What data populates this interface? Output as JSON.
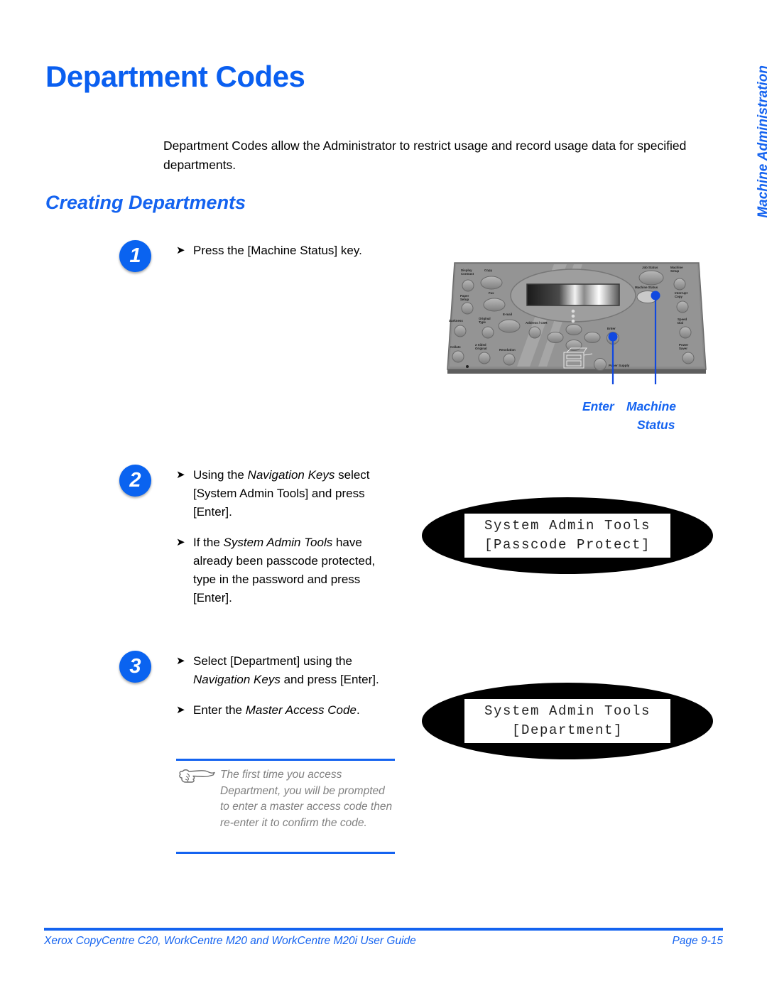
{
  "page": {
    "title": "Department Codes",
    "intro": "Department Codes allow the Administrator to restrict usage and record usage data for specified departments.",
    "section_heading": "Creating Departments",
    "side_tab": "Machine Administration",
    "title_color": "#0a5ff0",
    "accent_color": "#1463f0"
  },
  "steps": [
    {
      "number": "1",
      "bullets": [
        {
          "parts": [
            {
              "t": "Press the [Machine Status] key.",
              "style": "normal"
            }
          ]
        }
      ]
    },
    {
      "number": "2",
      "bullets": [
        {
          "parts": [
            {
              "t": "Using the ",
              "style": "normal"
            },
            {
              "t": "Navigation Keys",
              "style": "italic"
            },
            {
              "t": " select [System Admin Tools] and press [Enter].",
              "style": "normal"
            }
          ]
        },
        {
          "parts": [
            {
              "t": "If the ",
              "style": "normal"
            },
            {
              "t": "System Admin Tools",
              "style": "italic"
            },
            {
              "t": " have already been passcode protected, type in the password and press [Enter].",
              "style": "normal"
            }
          ]
        }
      ]
    },
    {
      "number": "3",
      "bullets": [
        {
          "parts": [
            {
              "t": "Select [Department] using the ",
              "style": "normal"
            },
            {
              "t": "Navigation Keys",
              "style": "italic"
            },
            {
              "t": " and press [Enter].",
              "style": "normal"
            }
          ]
        },
        {
          "parts": [
            {
              "t": "Enter the ",
              "style": "normal"
            },
            {
              "t": "Master Access Code",
              "style": "italic"
            },
            {
              "t": ".",
              "style": "normal"
            }
          ]
        }
      ]
    }
  ],
  "note": {
    "icon": "pointing-hand-icon",
    "text": "The first time you access Department, you will be prompted to enter a master access code then re-enter it to confirm the code.",
    "rule_color": "#1463f0",
    "text_color": "#808080"
  },
  "control_panel": {
    "callouts": [
      {
        "label": "Enter",
        "name": "callout-enter"
      },
      {
        "label": "Machine",
        "label2": "Status",
        "name": "callout-machine-status"
      }
    ],
    "buttons_left": [
      "Display Contrast",
      "Copy",
      "Fax",
      "Paper Setup",
      "E-mail",
      "Darkness",
      "Original Type",
      "Address / CSR",
      "Collate",
      "2 Sided Original",
      "Resolution"
    ],
    "buttons_right": [
      "Job Status",
      "Machine Setup",
      "Machine Status",
      "Interrupt Copy",
      "Speed Dial",
      "Power Saver / Stop / Start"
    ],
    "center_buttons": [
      "Navigation Keys",
      "Enter",
      "Paper Supply"
    ]
  },
  "lcd_displays": [
    {
      "name": "lcd-passcode-protect",
      "line1": "System Admin Tools",
      "line2": "[Passcode Protect]"
    },
    {
      "name": "lcd-department",
      "line1": "System Admin Tools",
      "line2": "[Department]"
    }
  ],
  "footer": {
    "left": "Xerox CopyCentre C20, WorkCentre M20 and WorkCentre M20i User Guide",
    "right": "Page 9-15"
  }
}
